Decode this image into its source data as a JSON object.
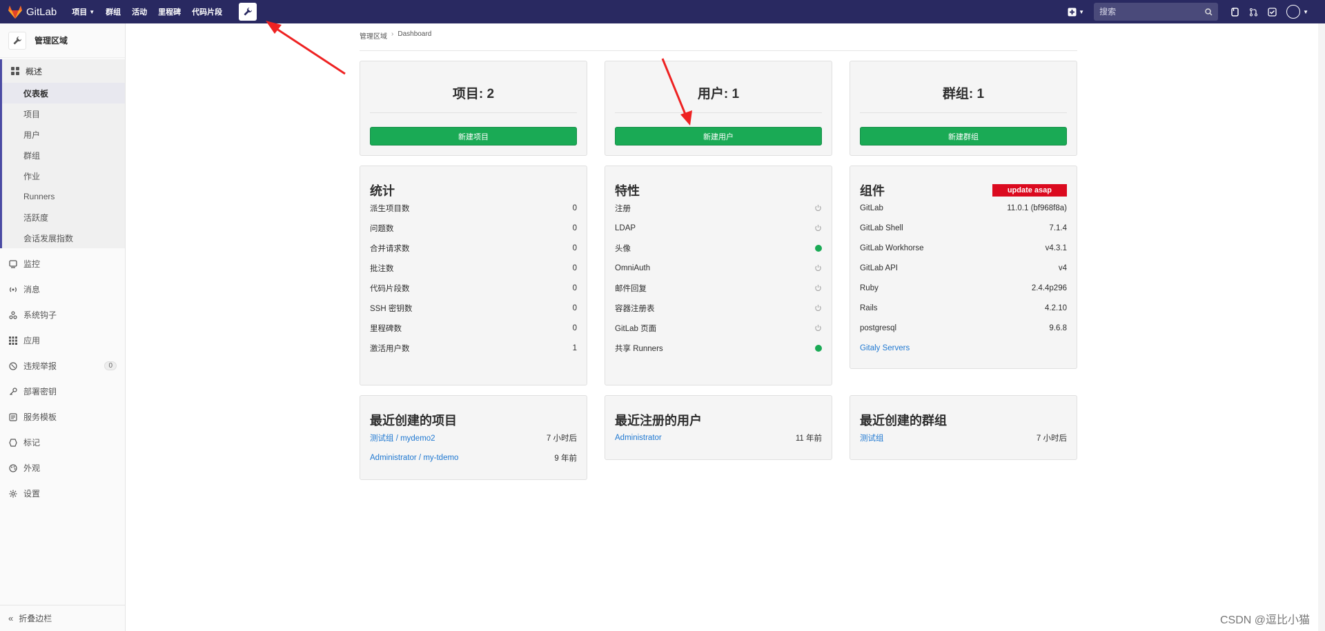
{
  "navbar": {
    "logo_text": "GitLab",
    "links": [
      {
        "label": "项目",
        "caret": true
      },
      {
        "label": "群组",
        "caret": false
      },
      {
        "label": "活动",
        "caret": false
      },
      {
        "label": "里程碑",
        "caret": false
      },
      {
        "label": "代码片段",
        "caret": false
      }
    ],
    "search_placeholder": "搜索"
  },
  "sidebar": {
    "header_title": "管理区域",
    "section": {
      "title": "概述",
      "items": [
        "仪表板",
        "项目",
        "用户",
        "群组",
        "作业",
        "Runners",
        "活跃度",
        "会话发展指数"
      ],
      "active_index": 0
    },
    "items": [
      {
        "label": "监控",
        "icon": "monitor-icon"
      },
      {
        "label": "消息",
        "icon": "broadcast-icon"
      },
      {
        "label": "系统钩子",
        "icon": "hook-icon"
      },
      {
        "label": "应用",
        "icon": "apps-icon"
      },
      {
        "label": "违规举报",
        "icon": "report-icon",
        "badge": "0"
      },
      {
        "label": "部署密钥",
        "icon": "key-icon"
      },
      {
        "label": "服务模板",
        "icon": "template-icon"
      },
      {
        "label": "标记",
        "icon": "label-icon"
      },
      {
        "label": "外观",
        "icon": "appearance-icon"
      },
      {
        "label": "设置",
        "icon": "settings-icon"
      }
    ],
    "collapse_label": "折叠边栏"
  },
  "breadcrumb": {
    "root": "管理区域",
    "current": "Dashboard"
  },
  "stats_cards": [
    {
      "title": "项目: 2",
      "button": "新建项目"
    },
    {
      "title": "用户: 1",
      "button": "新建用户"
    },
    {
      "title": "群组: 1",
      "button": "新建群组"
    }
  ],
  "statistics": {
    "title": "统计",
    "rows": [
      {
        "label": "派生项目数",
        "value": "0"
      },
      {
        "label": "问题数",
        "value": "0"
      },
      {
        "label": "合并请求数",
        "value": "0"
      },
      {
        "label": "批注数",
        "value": "0"
      },
      {
        "label": "代码片段数",
        "value": "0"
      },
      {
        "label": "SSH 密钥数",
        "value": "0"
      },
      {
        "label": "里程碑数",
        "value": "0"
      },
      {
        "label": "激活用户数",
        "value": "1"
      }
    ]
  },
  "features": {
    "title": "特性",
    "rows": [
      {
        "label": "注册",
        "on": false
      },
      {
        "label": "LDAP",
        "on": false
      },
      {
        "label": "头像",
        "on": true
      },
      {
        "label": "OmniAuth",
        "on": false
      },
      {
        "label": "邮件回复",
        "on": false
      },
      {
        "label": "容器注册表",
        "on": false
      },
      {
        "label": "GitLab 页面",
        "on": false
      },
      {
        "label": "共享 Runners",
        "on": true
      }
    ]
  },
  "components": {
    "title": "组件",
    "badge": "update asap",
    "rows": [
      {
        "label": "GitLab",
        "value": "11.0.1 (bf968f8a)"
      },
      {
        "label": "GitLab Shell",
        "value": "7.1.4"
      },
      {
        "label": "GitLab Workhorse",
        "value": "v4.3.1"
      },
      {
        "label": "GitLab API",
        "value": "v4"
      },
      {
        "label": "Ruby",
        "value": "2.4.4p296"
      },
      {
        "label": "Rails",
        "value": "4.2.10"
      },
      {
        "label": "postgresql",
        "value": "9.6.8"
      }
    ],
    "link": "Gitaly Servers"
  },
  "recent_projects": {
    "title": "最近创建的项目",
    "rows": [
      {
        "label": "测试组 / mydemo2",
        "value": "7 小时后"
      },
      {
        "label": "Administrator / my-tdemo",
        "value": "9 年前"
      }
    ]
  },
  "recent_users": {
    "title": "最近注册的用户",
    "rows": [
      {
        "label": "Administrator",
        "value": "11 年前"
      }
    ]
  },
  "recent_groups": {
    "title": "最近创建的群组",
    "rows": [
      {
        "label": "测试组",
        "value": "7 小时后"
      }
    ]
  },
  "watermark": "CSDN @逗比小猫",
  "colors": {
    "navbar": "#292961",
    "button_green": "#1aaa55",
    "link": "#1f78d1",
    "update_red": "#db0a1f",
    "annotation_arrow": "#ee2222"
  }
}
